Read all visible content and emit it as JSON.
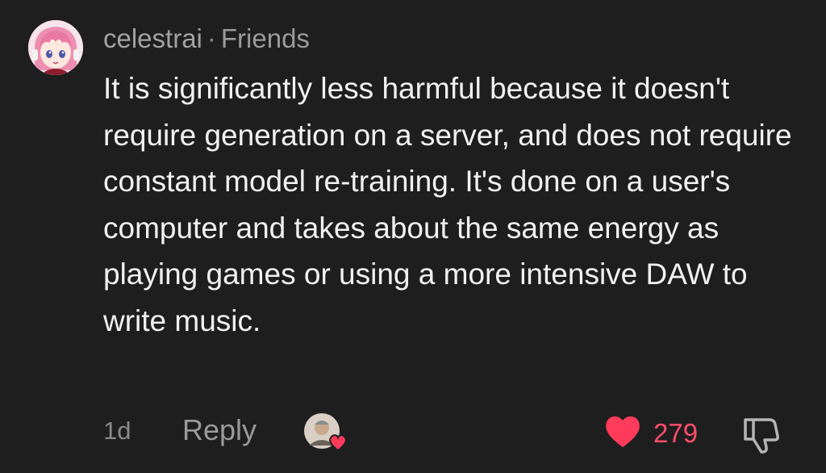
{
  "comment": {
    "author": "celestrai",
    "separator": "·",
    "relationship": "Friends",
    "text": "It is significantly less harmful because it doesn't require generation on a server, and does not require constant model re-training. It's done on a user's computer and takes about the same energy as playing games or using a more intensive DAW to write music.",
    "time": "1d",
    "reply_label": "Reply",
    "like_count": "279",
    "icons": {
      "avatar": "anime-avatar",
      "liker": "liker-avatar-with-heart",
      "like": "heart-icon",
      "dislike": "thumbs-down-icon"
    },
    "colors": {
      "background": "#1e1e1e",
      "like": "#ff4d6a"
    }
  }
}
